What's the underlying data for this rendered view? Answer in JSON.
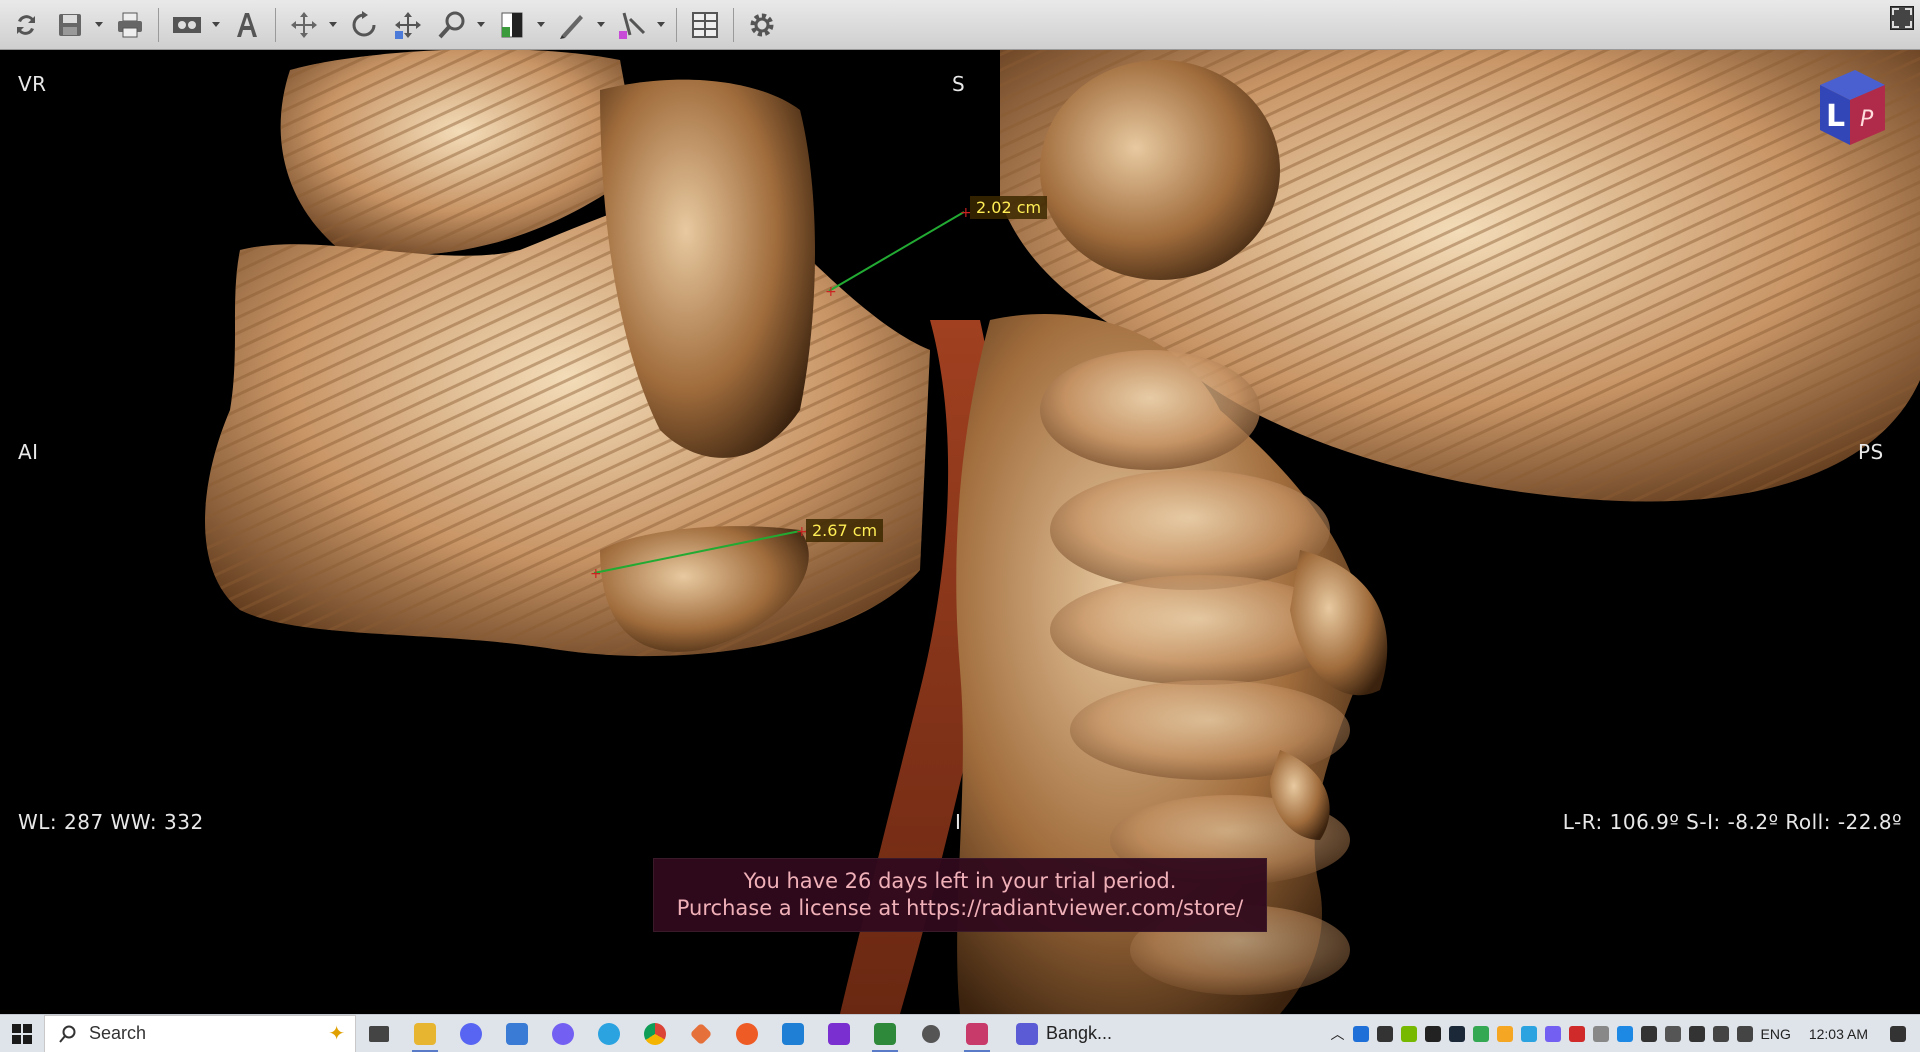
{
  "viewer": {
    "view_mode": "VR",
    "orientation": {
      "top": "S",
      "bottom": "I",
      "left": "AI",
      "right": "PS"
    },
    "window_level": "WL: 287 WW: 332",
    "rotation": "L-R: 106.9º S-I: -8.2º Roll: -22.8º",
    "cube": {
      "face_left": "L",
      "face_right": "P"
    },
    "measurements": [
      {
        "label": "2.02 cm"
      },
      {
        "label": "2.67 cm"
      }
    ],
    "trial_notice": {
      "line1": "You have 26 days left in your trial period.",
      "line2": "Purchase a license at https://radiantviewer.com/store/"
    }
  },
  "toolbar": {
    "icons": [
      "refresh-icon",
      "save-icon",
      "print-icon",
      "cine-icon",
      "annotation-text-icon",
      "pan-tool-icon",
      "rotate-icon",
      "move-icon",
      "zoom-icon",
      "window-level-icon",
      "draw-tool-icon",
      "measure-tool-icon",
      "layout-icon",
      "settings-icon"
    ]
  },
  "taskbar": {
    "search_placeholder": "Search",
    "media_title": "Bangk...",
    "language": "ENG",
    "time": "12:03 AM",
    "apps": [
      "task-view",
      "file-explorer",
      "discord",
      "photos",
      "viber",
      "telegram",
      "chrome",
      "git",
      "postman",
      "vscode",
      "app-j",
      "radiant",
      "settings",
      "app-k"
    ]
  },
  "colors": {
    "accent": "#5a7cc8",
    "measure_line": "#22aa33",
    "measure_text": "#ffee55",
    "trial_bg": "#300a1c"
  }
}
